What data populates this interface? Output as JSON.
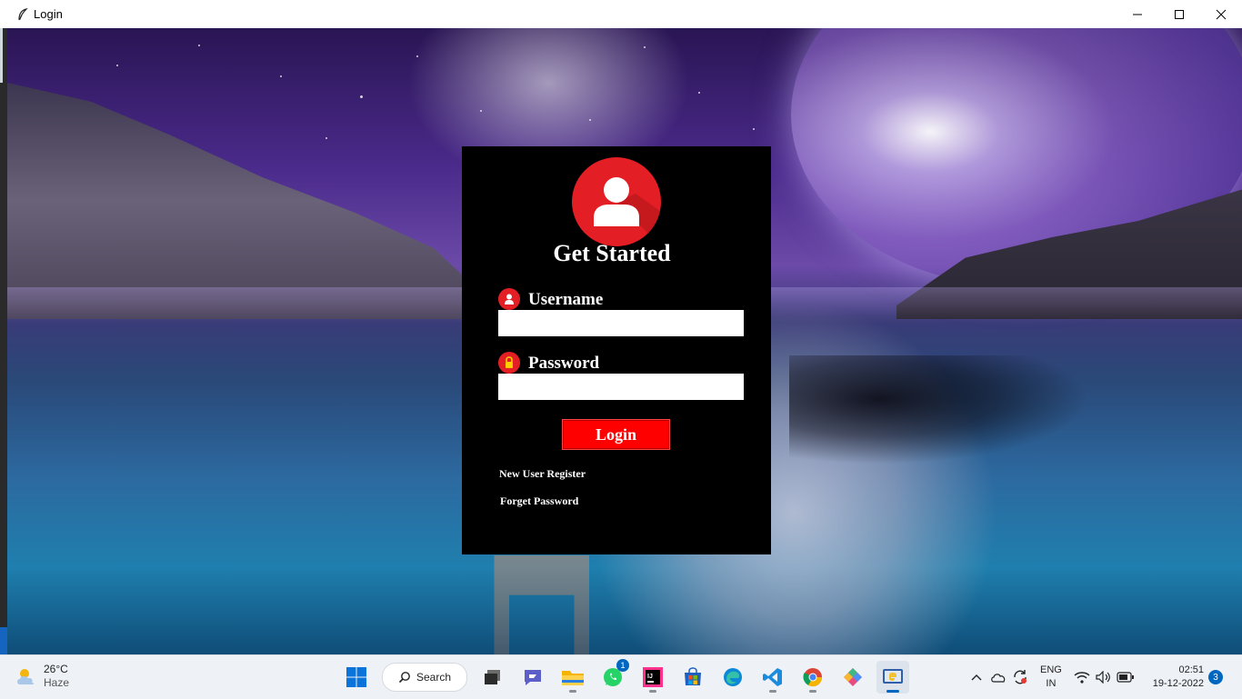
{
  "window": {
    "title": "Login"
  },
  "login": {
    "heading": "Get Started",
    "username_label": "Username",
    "username_value": "",
    "password_label": "Password",
    "password_value": "",
    "login_button": "Login",
    "register_link": "New User Register",
    "forgot_link": "Forget Password"
  },
  "taskbar": {
    "weather": {
      "temperature": "26°C",
      "condition": "Haze",
      "icon": "partly-cloudy-icon"
    },
    "search_label": "Search",
    "apps": [
      {
        "name": "windows-start-icon"
      },
      {
        "name": "task-view-icon"
      },
      {
        "name": "teams-chat-icon"
      },
      {
        "name": "file-explorer-icon"
      },
      {
        "name": "whatsapp-icon",
        "badge": "1"
      },
      {
        "name": "intellij-icon"
      },
      {
        "name": "microsoft-store-icon"
      },
      {
        "name": "edge-icon"
      },
      {
        "name": "vscode-icon"
      },
      {
        "name": "chrome-icon"
      },
      {
        "name": "app-icon"
      },
      {
        "name": "python-tk-icon"
      }
    ],
    "language": {
      "line1": "ENG",
      "line2": "IN"
    },
    "time": "02:51",
    "date": "19-12-2022",
    "notification_count": "3"
  },
  "colors": {
    "accent_red": "#e31e24",
    "button_red": "#ff0000",
    "panel_bg": "#000000",
    "taskbar_accent": "#0067c0"
  }
}
